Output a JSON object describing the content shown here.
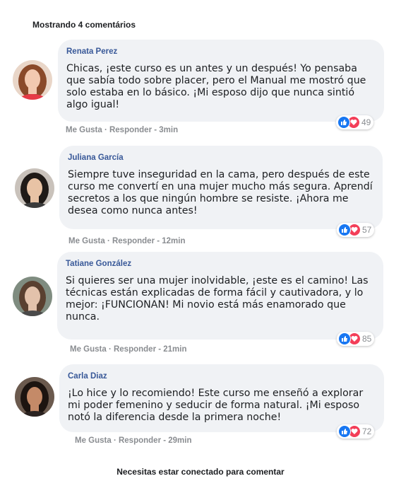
{
  "header": {
    "count_label": "Mostrando 4 comentários"
  },
  "comments": [
    {
      "author": "Renata Perez",
      "text": "Chicas, ¡este curso es un antes y un después! Yo pensaba que sabía todo sobre placer, pero el Manual me mostró que solo estaba en lo básico. ¡Mi esposo dijo que nunca sintió algo igual!",
      "reaction_count": "49",
      "actions": "Me Gusta · Responder - 3min"
    },
    {
      "author": "Juliana García",
      "text": "Siempre tuve inseguridad en la cama, pero después de este curso me convertí en una mujer mucho más segura. Aprendí secretos a los que ningún hombre se resiste. ¡Ahora me desea como nunca antes!",
      "reaction_count": "57",
      "actions": "Me Gusta · Responder -  12min"
    },
    {
      "author": "Tatiane González",
      "text": "Si quieres ser una mujer inolvidable, ¡este es el camino! Las técnicas están explicadas de forma fácil y cautivadora, y lo mejor: ¡FUNCIONAN! Mi novio está más enamorado que nunca.",
      "reaction_count": "85",
      "actions": "Me Gusta · Responder - 21min"
    },
    {
      "author": "Carla Diaz",
      "text": "¡Lo hice y lo recomiendo! Este curso me enseñó a explorar mi poder femenino y seducir de forma natural. ¡Mi esposo notó la diferencia desde la primera noche!",
      "reaction_count": "72",
      "actions": "Me Gusta · Responder - 29min"
    }
  ],
  "footer": {
    "label": "Necesitas estar conectado para comentar"
  },
  "colors": {
    "author": "#385898",
    "bubble": "#f0f2f5",
    "like": "#1877f2",
    "love": "#f33e58",
    "muted": "#8a8d91"
  }
}
